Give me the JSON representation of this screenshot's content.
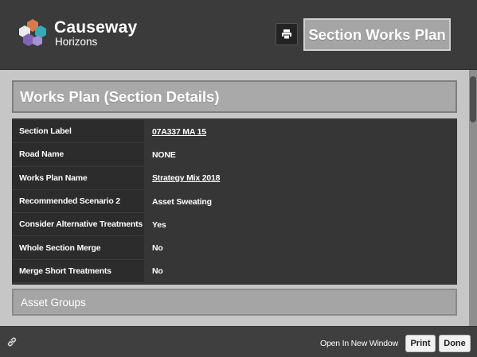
{
  "header": {
    "brand_name": "Causeway",
    "brand_sub": "Horizons",
    "title": "Section Works Plan",
    "print_icon": "printer-icon"
  },
  "section": {
    "title": "Works Plan (Section Details)",
    "rows": [
      {
        "label": "Section Label",
        "value": "07A337 MA 15",
        "link": true
      },
      {
        "label": "Road Name",
        "value": "NONE",
        "link": false
      },
      {
        "label": "Works Plan Name",
        "value": "Strategy Mix 2018",
        "link": true
      },
      {
        "label": "Recommended Scenario 2",
        "value": "Asset Sweating",
        "link": false
      },
      {
        "label": "Consider Alternative Treatments",
        "value": "Yes",
        "link": false
      },
      {
        "label": "Whole Section Merge",
        "value": "No",
        "link": false
      },
      {
        "label": "Merge Short Treatments",
        "value": "No",
        "link": false
      }
    ]
  },
  "asset_groups": {
    "title": "Asset Groups"
  },
  "footer": {
    "link_icon": "link-icon",
    "open_new_window": "Open In New Window",
    "print_label": "Print",
    "done_label": "Done"
  },
  "colors": {
    "logo_orange": "#d9784a",
    "logo_teal": "#3aa7b4",
    "logo_purple": "#8065b5",
    "header_bg": "#3b3b3b",
    "content_bg": "#c6c6c6"
  }
}
